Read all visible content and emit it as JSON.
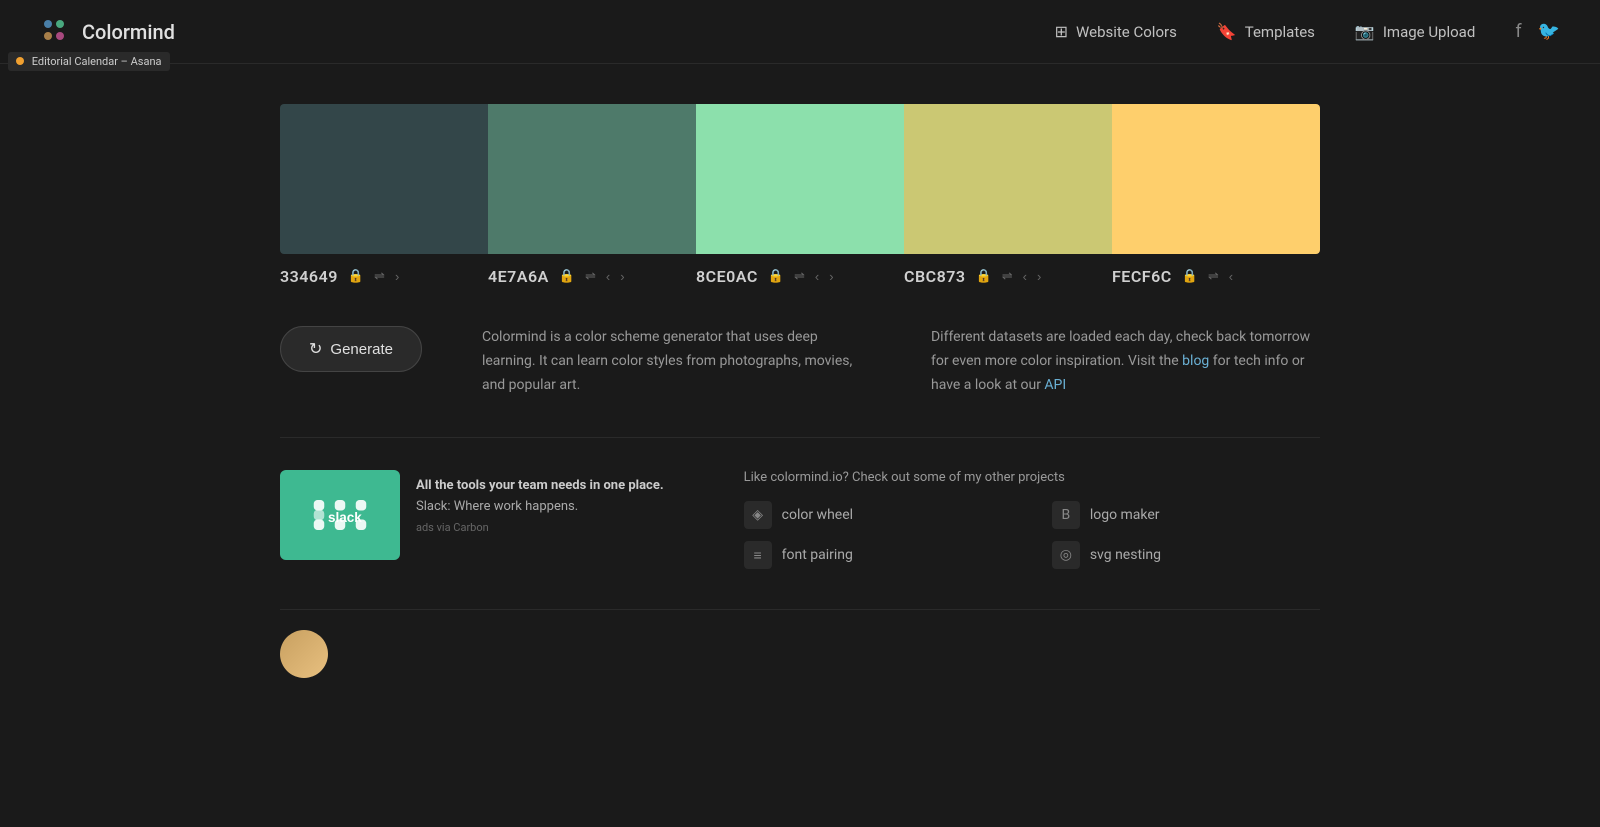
{
  "browser_tooltip": "Editorial Calendar – Asana",
  "header": {
    "logo_text": "Colormind",
    "nav": {
      "website_colors": "Website Colors",
      "templates": "Templates",
      "image_upload": "Image Upload"
    }
  },
  "palette": {
    "colors": [
      {
        "hex": "334649",
        "value": "#334649"
      },
      {
        "hex": "4E7A6A",
        "value": "#4E7A6A"
      },
      {
        "hex": "8CE0AC",
        "value": "#8CE0AC"
      },
      {
        "hex": "CBC873",
        "value": "#CBC873"
      },
      {
        "hex": "FECF6C",
        "value": "#FECF6C"
      }
    ]
  },
  "generate_button": "Generate",
  "description_left": "Colormind is a color scheme generator that uses deep learning. It can learn color styles from photographs, movies, and popular art.",
  "description_right_text": "Different datasets are loaded each day, check back tomorrow for even more color inspiration. Visit the ",
  "description_blog": "blog",
  "description_middle": " for tech info or have a look at our ",
  "description_api": "API",
  "ad": {
    "title": "All the tools your team needs in one place.",
    "subtitle": "Slack: Where work happens.",
    "sponsor": "ads via Carbon",
    "logo_hash": "#",
    "logo_text": "slack"
  },
  "projects": {
    "title": "Like colormind.io? Check out some of my other projects",
    "items": [
      {
        "name": "color wheel",
        "icon": "◈"
      },
      {
        "name": "logo maker",
        "icon": "B"
      },
      {
        "name": "font pairing",
        "icon": "≡"
      },
      {
        "name": "svg nesting",
        "icon": "◎"
      }
    ]
  }
}
